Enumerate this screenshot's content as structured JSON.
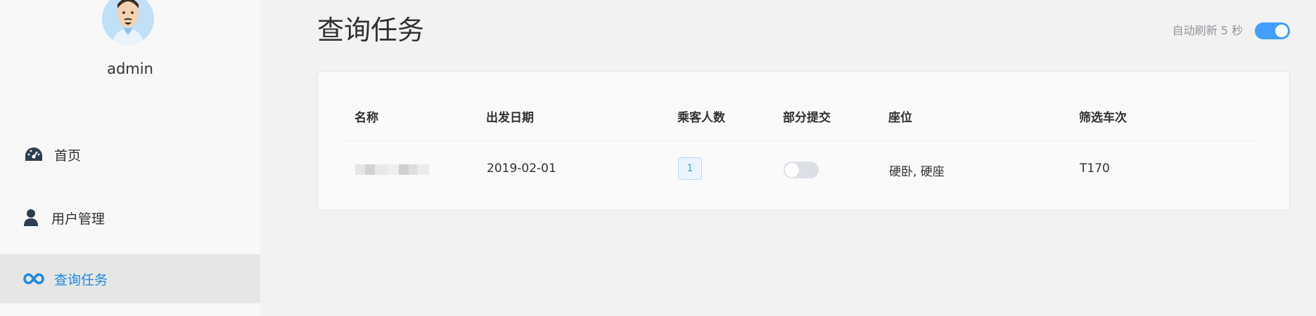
{
  "sidebar": {
    "username": "admin",
    "items": [
      {
        "label": "首页",
        "icon": "dashboard-icon"
      },
      {
        "label": "用户管理",
        "icon": "user-icon"
      },
      {
        "label": "查询任务",
        "icon": "infinity-icon",
        "active": true
      }
    ]
  },
  "main": {
    "title": "查询任务",
    "auto_refresh_label": "自动刷新 5 秒",
    "auto_refresh_on": true,
    "table": {
      "columns": [
        "名称",
        "出发日期",
        "乘客人数",
        "部分提交",
        "座位",
        "筛选车次"
      ],
      "rows": [
        {
          "date": "2019-02-01",
          "passengers": "1",
          "partial_submit": false,
          "seats": "硬卧, 硬座",
          "trains": "T170"
        }
      ]
    }
  },
  "colors": {
    "accent": "#409eff",
    "active_nav": "#1e88e5"
  }
}
